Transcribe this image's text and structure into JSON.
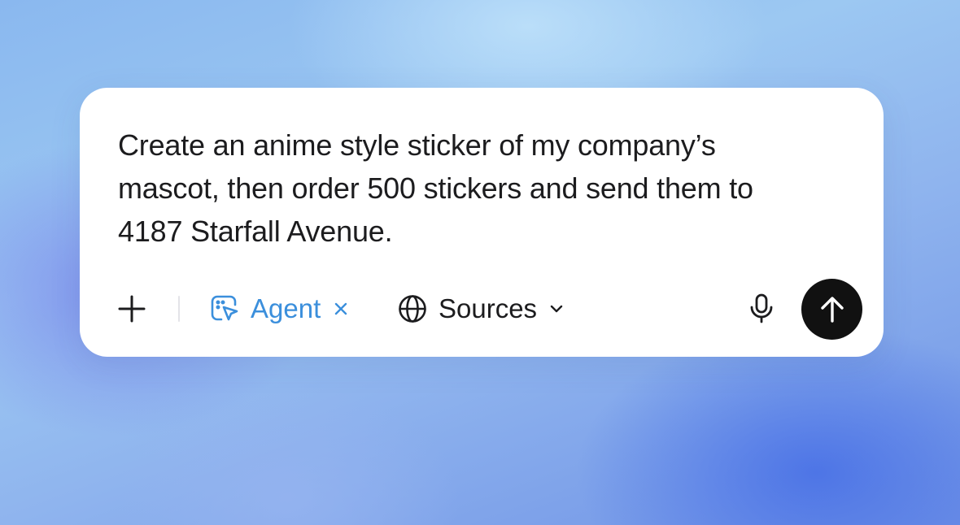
{
  "composer": {
    "prompt_text": "Create an anime style sticker of my company’s\nmascot, then order 500 stickers and send them to\n4187 Starfall Avenue."
  },
  "toolbar": {
    "add_icon": "plus-icon",
    "agent": {
      "icon": "agent-cursor-icon",
      "label": "Agent",
      "remove_icon": "close-icon",
      "color": "#3b8fdc"
    },
    "sources": {
      "icon": "globe-icon",
      "label": "Sources",
      "dropdown_icon": "chevron-down-icon"
    },
    "mic_icon": "microphone-icon",
    "send_icon": "arrow-up-icon",
    "send_color": "#111111"
  }
}
